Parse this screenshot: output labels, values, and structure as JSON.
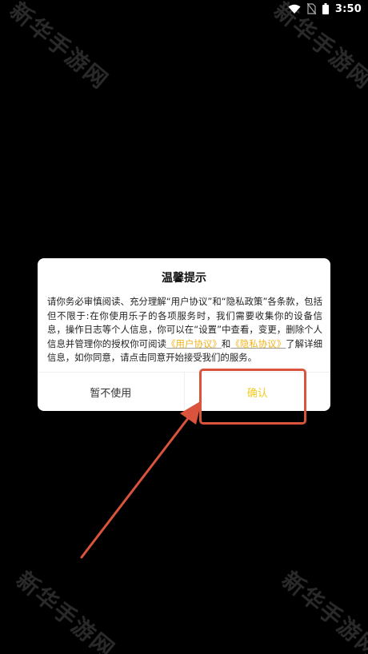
{
  "status_bar": {
    "time": "3:50",
    "icons": [
      "wifi-icon",
      "no-sim-icon",
      "battery-icon"
    ]
  },
  "watermark": {
    "text": "新华手游网"
  },
  "dialog": {
    "title": "温馨提示",
    "body_part1": "请你务必审慎阅读、充分理解“用户协议”和“隐私政策”各条款，包括但不限于:在你使用乐子的各项服务时，我们需要收集你的设备信息，操作日志等个人信息，你可以在“设置”中查看，变更，删除个人信息并管理你的授权你可阅读",
    "link_user_agreement": "《用户协议》",
    "body_and": "和",
    "link_privacy_policy": "《隐私协议》",
    "body_part2": "了解详细信息，如你同意，请点击同意开始接受我们的服务。",
    "cancel_label": "暂不使用",
    "confirm_label": "确认"
  },
  "colors": {
    "background": "#000000",
    "dialog_bg": "#ffffff",
    "link": "#f2b31a",
    "confirm": "#f2cc1f",
    "annotation": "#d9533d"
  }
}
